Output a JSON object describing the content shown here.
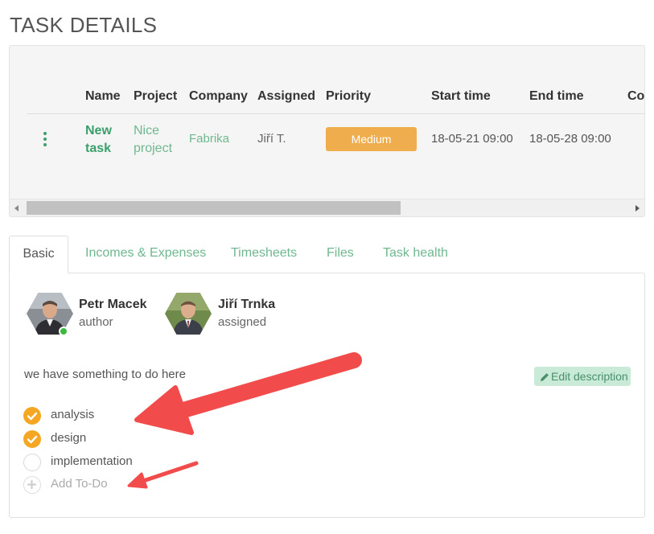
{
  "page": {
    "title": "TASK DETAILS"
  },
  "table": {
    "columns": [
      "Name",
      "Project",
      "Company",
      "Assigned",
      "Priority",
      "Start time",
      "End time",
      "Com"
    ],
    "row": {
      "name_line1": "New",
      "name_line2": "task",
      "project_line1": "Nice",
      "project_line2": "project",
      "company": "Fabrika",
      "assigned": "Jiří T.",
      "priority": "Medium",
      "start_time": "18-05-21 09:00",
      "end_time": "18-05-28 09:00"
    }
  },
  "tabs": [
    {
      "label": "Basic",
      "active": true
    },
    {
      "label": "Incomes & Expenses",
      "active": false
    },
    {
      "label": "Timesheets",
      "active": false
    },
    {
      "label": "Files",
      "active": false
    },
    {
      "label": "Task health",
      "active": false
    }
  ],
  "people": [
    {
      "name": "Petr Macek",
      "role": "author",
      "online": true
    },
    {
      "name": "Jiří Trnka",
      "role": "assigned",
      "online": false
    }
  ],
  "description": "we have something to do here",
  "edit_description_label": "Edit description",
  "todos": [
    {
      "label": "analysis",
      "done": true
    },
    {
      "label": "design",
      "done": true
    },
    {
      "label": "implementation",
      "done": false
    }
  ],
  "add_todo_label": "Add To-Do",
  "colors": {
    "accent_green": "#3aa06b",
    "priority_medium": "#f0ad4e",
    "todo_done": "#f5a623",
    "annotation_arrow": "#f24b4b"
  }
}
